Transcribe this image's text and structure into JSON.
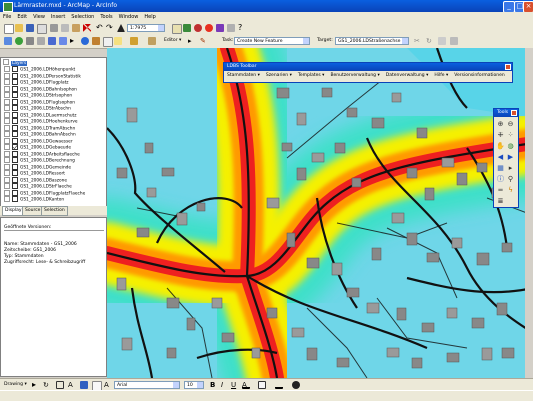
{
  "window": {
    "title": "Lärmraster.mxd - ArcMap - ArcInfo"
  },
  "menu": [
    "File",
    "Edit",
    "View",
    "Insert",
    "Selection",
    "Tools",
    "Window",
    "Help"
  ],
  "toolbar": {
    "scale": "1:7975",
    "editor_label": "Editor ▾",
    "task_label": "Task:",
    "task_value": "Create New Feature",
    "target_label": "Target:",
    "target_value": "GS1_2006.LDStraßenachse"
  },
  "toc": {
    "root": "Layers",
    "layers": [
      {
        "name": "GS1_2006.LDHöhenpunkt",
        "checked": false
      },
      {
        "name": "GS1_2006.LDPersonStatistik",
        "checked": false
      },
      {
        "name": "GS1_2006.LDFlugplatz",
        "checked": false
      },
      {
        "name": "GS1_2006.LDBahnIsophon",
        "checked": false
      },
      {
        "name": "GS1_2006.LDStrIsophon",
        "checked": false
      },
      {
        "name": "GS1_2006.LDFlugIsophon",
        "checked": false
      },
      {
        "name": "GS1_2006.LDStrAbschn",
        "checked": false
      },
      {
        "name": "GS1_2006.LDLaermschutz",
        "checked": false
      },
      {
        "name": "GS1_2006.LDHoehenkurve",
        "checked": false
      },
      {
        "name": "GS1_2006.LDTramAbschn",
        "checked": false
      },
      {
        "name": "GS1_2006.LDBahnAbschn",
        "checked": false
      },
      {
        "name": "GS1_2006.LDGewaesser",
        "checked": false
      },
      {
        "name": "GS1_2006.LDGebaeude",
        "checked": true
      },
      {
        "name": "GS1_2006.LDArbeitsflaeche",
        "checked": false
      },
      {
        "name": "GS1_2006.LDBerechnung",
        "checked": false
      },
      {
        "name": "GS1_2006.LDGemeinde",
        "checked": false
      },
      {
        "name": "GS1_2006.LDRessort",
        "checked": false
      },
      {
        "name": "GS1_2006.LDBaszone",
        "checked": false
      },
      {
        "name": "GS1_2006.LDStrFlaeche",
        "checked": false
      },
      {
        "name": "GS1_2006.LDFlugplatzFlaeche",
        "checked": false
      },
      {
        "name": "GS1_2006.LDKanton",
        "checked": false
      }
    ],
    "tabs": [
      "Display",
      "Source",
      "Selection"
    ]
  },
  "info": {
    "header": "Geöffnete Versionen:",
    "name": "Name: Stammdaten - GS1_2006",
    "zeitscheibe": "Zeitscheibe: GS1_2006",
    "typ": "Typ: Stammdaten",
    "zugriff": "Zugriffsrecht: Lese- & Schreibzugriff"
  },
  "ldbs": {
    "title": "LDBS Toolbar",
    "menu": [
      "Stammdaten ▾",
      "Szenarien ▾",
      "Templates ▾",
      "Benutzerverwaltung ▾",
      "Datenverwaltung ▾",
      "Hilfe ▾",
      "Versionsinformationen"
    ]
  },
  "tools": {
    "title": "Tools"
  },
  "drawing": {
    "label": "Drawing ▾",
    "font": "Arial",
    "size": "10"
  },
  "colors": {
    "titlebar": "#0a43b8",
    "menu_bg": "#ece9d8",
    "noise_yellow": "#f5f000",
    "noise_red": "#ee2020",
    "noise_cyan": "#50e8f0"
  }
}
